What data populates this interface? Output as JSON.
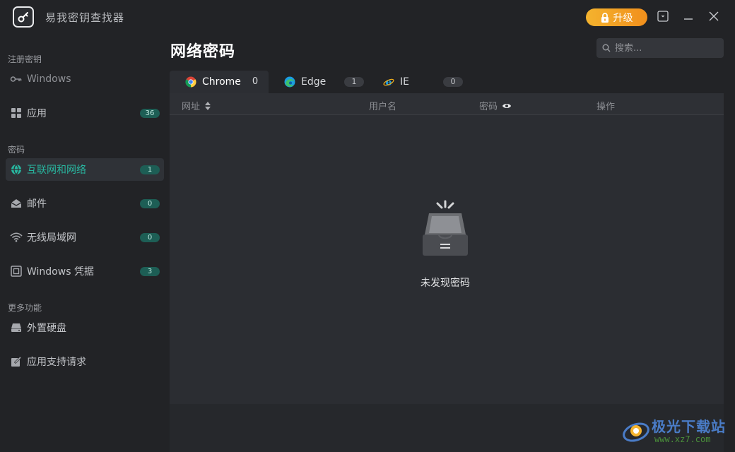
{
  "app": {
    "title": "易我密钥查找器",
    "upgrade_label": "升级"
  },
  "sidebar": {
    "sections": [
      {
        "label": "注册密钥"
      },
      {
        "label": "密码"
      },
      {
        "label": "更多功能"
      }
    ],
    "items": [
      {
        "label": "Windows",
        "icon": "key-icon"
      },
      {
        "label": "应用",
        "icon": "apps-grid-icon",
        "badge": "36"
      },
      {
        "label": "互联网和网络",
        "icon": "globe-icon",
        "badge": "1",
        "active": true
      },
      {
        "label": "邮件",
        "icon": "mail-icon",
        "badge": "0"
      },
      {
        "label": "无线局域网",
        "icon": "wifi-icon",
        "badge": "0"
      },
      {
        "label": "Windows 凭据",
        "icon": "credential-icon",
        "badge": "3"
      },
      {
        "label": "外置硬盘",
        "icon": "external-drive-icon"
      },
      {
        "label": "应用支持请求",
        "icon": "edit-request-icon"
      }
    ]
  },
  "main": {
    "title": "网络密码",
    "search_placeholder": "搜索...",
    "tabs": [
      {
        "label": "Chrome",
        "count": "0",
        "active": true
      },
      {
        "label": "Edge",
        "count": "1"
      },
      {
        "label": "IE",
        "count": "0"
      }
    ],
    "columns": [
      "网址",
      "用户名",
      "密码",
      "操作"
    ],
    "empty_text": "未发现密码"
  },
  "watermark": {
    "title": "极光下载站",
    "url": "www.xz7.com"
  },
  "colors": {
    "accent": "#28b7a0",
    "upgrade": "#f4a324",
    "background": "#222326",
    "panel": "#2b2d32"
  }
}
